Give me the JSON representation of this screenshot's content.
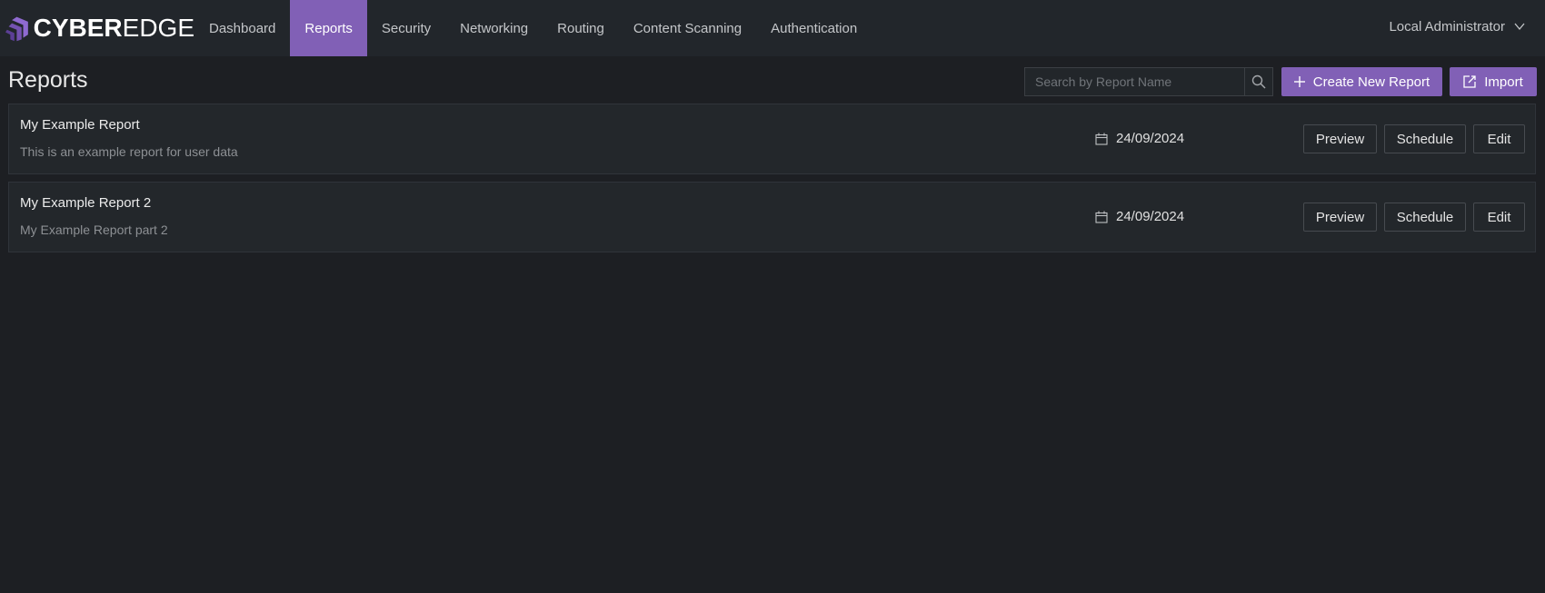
{
  "app": {
    "logo_bold": "CYBER",
    "logo_light": "EDGE",
    "brand_color": "#8160b6"
  },
  "nav": {
    "items": [
      {
        "label": "Dashboard",
        "active": false
      },
      {
        "label": "Reports",
        "active": true
      },
      {
        "label": "Security",
        "active": false
      },
      {
        "label": "Networking",
        "active": false
      },
      {
        "label": "Routing",
        "active": false
      },
      {
        "label": "Content Scanning",
        "active": false
      },
      {
        "label": "Authentication",
        "active": false
      }
    ],
    "user_menu": {
      "label": "Local Administrator",
      "icon": "chevron-down-icon"
    }
  },
  "page": {
    "title": "Reports",
    "search": {
      "placeholder": "Search by Report Name",
      "value": "",
      "icon": "search-icon"
    },
    "create_button": {
      "label": "Create New Report",
      "icon": "plus-icon"
    },
    "import_button": {
      "label": "Import",
      "icon": "import-icon"
    }
  },
  "reports": [
    {
      "name": "My Example Report",
      "description": "This is an example report for user data",
      "date": "24/09/2024",
      "actions": {
        "preview": "Preview",
        "schedule": "Schedule",
        "edit": "Edit"
      }
    },
    {
      "name": "My Example Report 2",
      "description": "My Example Report part 2",
      "date": "24/09/2024",
      "actions": {
        "preview": "Preview",
        "schedule": "Schedule",
        "edit": "Edit"
      }
    }
  ]
}
